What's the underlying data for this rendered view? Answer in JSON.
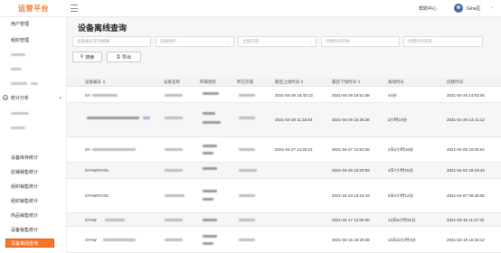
{
  "header": {
    "brand": "运营平台",
    "help": "帮助中心",
    "username": "Gina区"
  },
  "sidebar": {
    "items": [
      {
        "label": "用户管理"
      },
      {
        "label": "组织管理"
      },
      {
        "label": "统计分析"
      },
      {
        "label": "设备库存统计"
      },
      {
        "label": "店铺销售统计"
      },
      {
        "label": "组织销售统计"
      },
      {
        "label": "组织销售统计"
      },
      {
        "label": "商品销售统计"
      },
      {
        "label": "设备销售统计"
      },
      {
        "label": "设备离线查询"
      }
    ]
  },
  "page": {
    "title": "设备离线查询"
  },
  "filters": {
    "device_code_placeholder": "设备编号支持模糊",
    "org_placeholder": "选择组织",
    "store_placeholder": "全部店铺",
    "start_placeholder": "创建时间开始",
    "end_placeholder": "创建时间结束"
  },
  "buttons": {
    "search": "搜索",
    "export": "导出"
  },
  "table": {
    "headers": [
      "设备编号",
      "设备名称",
      "所属组织",
      "所在店铺",
      "最后上线时间",
      "最后下线时间",
      "离线时长",
      "创建时间"
    ],
    "rows": [
      {
        "code": "SY",
        "last_online": "2021-04-29 16:40:13",
        "last_offline": "2021-04-29 16:51:58",
        "duration": "44分",
        "created": "2021-04-25 14:53:45"
      },
      {
        "code": "",
        "last_online": "2021-04-28 11:15:04",
        "last_offline": "2021-04-29 15:26:26",
        "duration": "2小时10分",
        "created": "2021-01-25 13:41:12"
      },
      {
        "code": "SY",
        "last_online": "2021-04-27 14:26:21",
        "last_offline": "2021-04-27 14:53:36",
        "duration": "2天2小时43分",
        "created": "2021-04-09 10:05:04"
      },
      {
        "code": "SYAW2YAOL",
        "last_online": "",
        "last_offline": "2021-04-25 10:20:59",
        "duration": "4天7小时15分",
        "created": "2021-04-02 19:19:43"
      },
      {
        "code": "SYAW2YAOL",
        "last_online": "",
        "last_offline": "2021-04-23 15:24:18",
        "duration": "6天2小时12分",
        "created": "2021-04-07 09:49:36"
      },
      {
        "code": "SYAW",
        "last_online": "",
        "last_offline": "2021-04-17 12:05:00",
        "duration": "12天5小时31分",
        "created": "2021-03-15 11:47:32"
      },
      {
        "code": "SYAW",
        "last_online": "",
        "last_offline": "2021-04-15 19:28:38",
        "duration": "13天22小时4分",
        "created": "2021-02-19 15:33:12"
      }
    ]
  }
}
